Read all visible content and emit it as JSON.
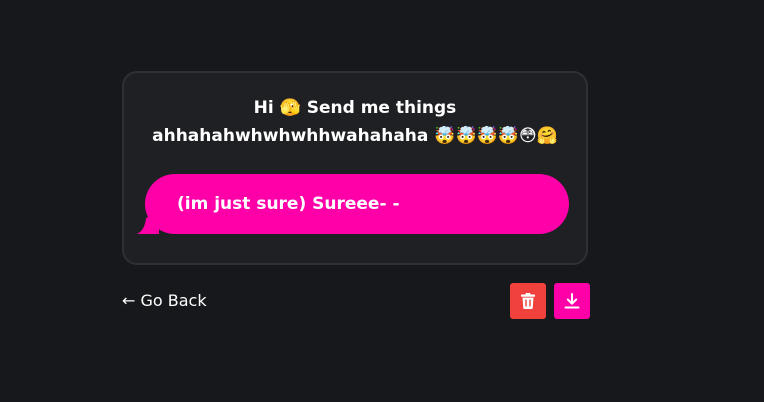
{
  "card": {
    "prompt": "Hi 🫣 Send me things ahhahahwhwhwhhwahahaha 🤯🤯🤯🤯😳🤗"
  },
  "message": {
    "text": "(im just sure) Sureee- -"
  },
  "actions": {
    "back_label": "← Go Back",
    "delete_icon": "trash-icon",
    "download_icon": "download-icon"
  },
  "colors": {
    "background": "#17181b",
    "card": "#1f2024",
    "accent": "#ff00a8",
    "danger": "#f0413c"
  }
}
